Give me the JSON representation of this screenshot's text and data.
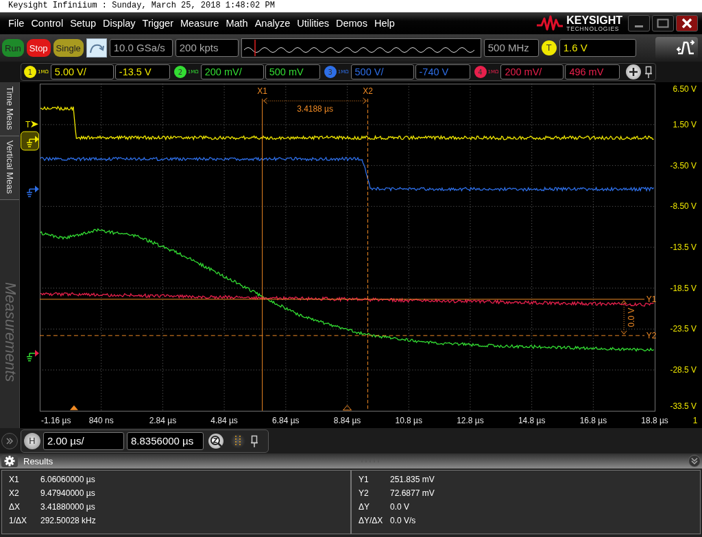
{
  "window": {
    "title": "Keysight Infiniium : Sunday, March 25, 2018 1:48:02 PM"
  },
  "menu": [
    "File",
    "Control",
    "Setup",
    "Display",
    "Trigger",
    "Measure",
    "Math",
    "Analyze",
    "Utilities",
    "Demos",
    "Help"
  ],
  "logo": {
    "name": "KEYSIGHT",
    "tagline": "TECHNOLOGIES"
  },
  "toolbar": {
    "buttons": [
      {
        "label": "Run",
        "kind": "run"
      },
      {
        "label": "Stop",
        "kind": "stop"
      },
      {
        "label": "Single",
        "kind": "single"
      }
    ],
    "sample_rate": "10.0 GSa/s",
    "memory_depth": "200 kpts",
    "bandwidth": "500 MHz",
    "trigger_badge": "T",
    "trigger_level": "1.6 V"
  },
  "channels": [
    {
      "number": "1",
      "impedance": "1MΩ",
      "scale": "5.00 V/",
      "offset": "-13.5 V",
      "color": "#f0e800"
    },
    {
      "number": "2",
      "impedance": "1MΩ",
      "scale": "200 mV/",
      "offset": "500 mV",
      "color": "#33dd33"
    },
    {
      "number": "3",
      "impedance": "1MΩ",
      "scale": "500 V/",
      "offset": "-740 V",
      "color": "#2e6fe8"
    },
    {
      "number": "4",
      "impedance": "1MΩ",
      "scale": "200 mV/",
      "offset": "496 mV",
      "color": "#e8204c"
    }
  ],
  "side_tabs": [
    {
      "label": "Time Meas",
      "kind": "tab"
    },
    {
      "label": "Vertical Meas",
      "kind": "tab"
    },
    {
      "label": "Measurements",
      "kind": "watermark"
    }
  ],
  "display": {
    "y_labels": [
      "6.50 V",
      "1.50 V",
      "-3.50 V",
      "-8.50 V",
      "-13.5 V",
      "-18.5 V",
      "-23.5 V",
      "-28.5 V",
      "-33.5 V"
    ],
    "x_labels": [
      "-1.16 µs",
      "840 ns",
      "2.84 µs",
      "4.84 µs",
      "6.84 µs",
      "8.84 µs",
      "10.8 µs",
      "12.8 µs",
      "14.8 µs",
      "16.8 µs",
      "18.8 µs"
    ],
    "corner_label": "1",
    "trigger_marker": "T",
    "x1_label": "X1",
    "x2_label": "X2",
    "delta_x": "3.4188 µs",
    "y1_label": "Y1",
    "y2_label": "Y2",
    "delta_y": "0.0 V"
  },
  "horizontal": {
    "badge": "H",
    "scale": "2.00 µs/",
    "position": "8.8356000 µs"
  },
  "results": {
    "title": "Results",
    "columns": [
      [
        {
          "name": "X1",
          "value": "6.06060000 µs"
        },
        {
          "name": "X2",
          "value": "9.47940000 µs"
        },
        {
          "name": "ΔX",
          "value": "3.41880000 µs"
        },
        {
          "name": "1/ΔX",
          "value": "292.50028 kHz"
        }
      ],
      [
        {
          "name": "Y1",
          "value": "251.835 mV"
        },
        {
          "name": "Y2",
          "value": "72.6877 mV"
        },
        {
          "name": "ΔY",
          "value": "0.0 V"
        },
        {
          "name": "ΔY/ΔX",
          "value": "0.0 V/s"
        }
      ]
    ]
  }
}
